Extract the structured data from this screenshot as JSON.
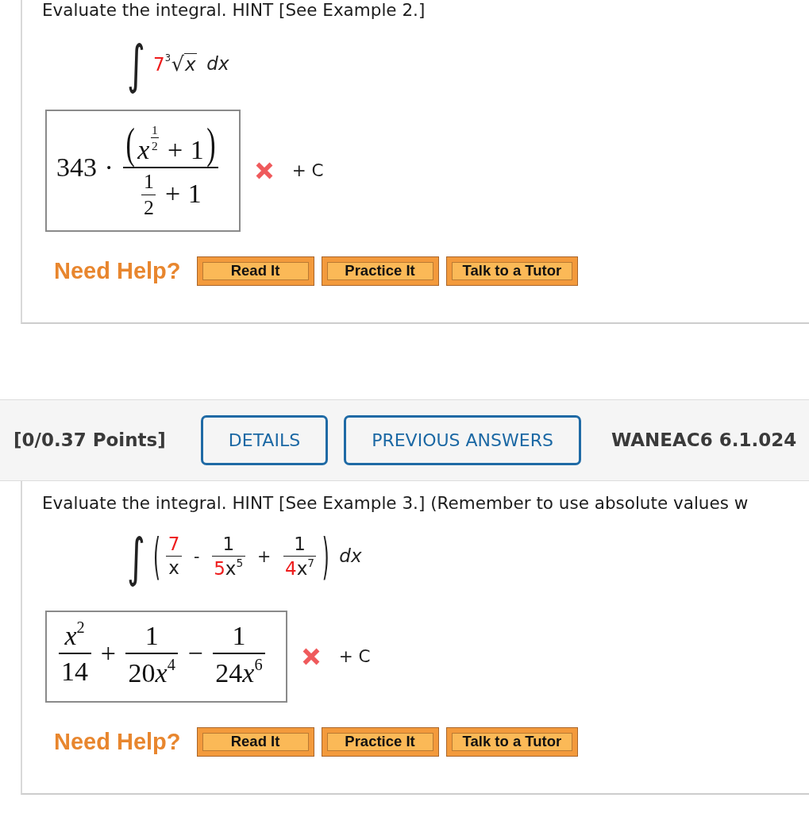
{
  "questions": [
    {
      "prompt": "Evaluate the integral. HINT [See Example 2.]",
      "integral": {
        "kind": "integral",
        "sign": "∫",
        "body": [
          {
            "kind": "param",
            "text": "7"
          },
          {
            "kind": "root",
            "index": "3",
            "sign": "√",
            "body": [
              {
                "kind": "var",
                "text": "x",
                "italic": true
              }
            ]
          }
        ],
        "differential": "dx"
      },
      "answer": [
        {
          "kind": "num",
          "text": "343"
        },
        {
          "kind": "op",
          "text": "·"
        },
        {
          "kind": "frac",
          "num": [
            {
              "kind": "paren",
              "open": "(",
              "close": ")",
              "body": [
                {
                  "kind": "var",
                  "text": "x",
                  "italic": true
                },
                {
                  "kind": "sup",
                  "body": [
                    {
                      "kind": "frac",
                      "num": [
                        {
                          "kind": "num",
                          "text": "1"
                        }
                      ],
                      "den": [
                        {
                          "kind": "num",
                          "text": "2"
                        }
                      ]
                    }
                  ]
                },
                {
                  "kind": "op",
                  "text": "+"
                },
                {
                  "kind": "num",
                  "text": "1"
                }
              ]
            }
          ],
          "den": [
            {
              "kind": "frac",
              "num": [
                {
                  "kind": "num",
                  "text": "1"
                }
              ],
              "den": [
                {
                  "kind": "num",
                  "text": "2"
                }
              ]
            },
            {
              "kind": "op",
              "text": "+"
            },
            {
              "kind": "num",
              "text": "1"
            }
          ]
        }
      ],
      "correct": false,
      "constant": "+ C",
      "help": {
        "label": "Need Help?",
        "buttons": [
          "Read It",
          "Practice It",
          "Talk to a Tutor"
        ]
      }
    },
    {
      "header": {
        "points": "[0/0.37 Points]",
        "buttons": [
          "DETAILS",
          "PREVIOUS ANSWERS"
        ],
        "reference": "WANEAC6 6.1.024"
      },
      "prompt": "Evaluate the integral. HINT [See Example 3.] (Remember to use absolute values w",
      "integral": {
        "kind": "integral",
        "sign": "∫",
        "body": [
          {
            "kind": "paren",
            "open": "(",
            "close": ")",
            "body": [
              {
                "kind": "frac",
                "num": [
                  {
                    "kind": "param",
                    "text": "7"
                  }
                ],
                "den": [
                  {
                    "kind": "var",
                    "text": "x",
                    "italic": false
                  }
                ]
              },
              {
                "kind": "op",
                "text": "-"
              },
              {
                "kind": "frac",
                "num": [
                  {
                    "kind": "num",
                    "text": "1"
                  }
                ],
                "den": [
                  {
                    "kind": "param",
                    "text": "5"
                  },
                  {
                    "kind": "var",
                    "text": "x",
                    "italic": false
                  },
                  {
                    "kind": "sup",
                    "body": [
                      {
                        "kind": "num",
                        "text": "5"
                      }
                    ]
                  }
                ]
              },
              {
                "kind": "op",
                "text": "+"
              },
              {
                "kind": "frac",
                "num": [
                  {
                    "kind": "num",
                    "text": "1"
                  }
                ],
                "den": [
                  {
                    "kind": "param",
                    "text": "4"
                  },
                  {
                    "kind": "var",
                    "text": "x",
                    "italic": false
                  },
                  {
                    "kind": "sup",
                    "body": [
                      {
                        "kind": "num",
                        "text": "7"
                      }
                    ]
                  }
                ]
              }
            ]
          }
        ],
        "differential": "dx"
      },
      "answer": [
        {
          "kind": "frac",
          "num": [
            {
              "kind": "var",
              "text": "x",
              "italic": true
            },
            {
              "kind": "sup",
              "body": [
                {
                  "kind": "num",
                  "text": "2"
                }
              ]
            }
          ],
          "den": [
            {
              "kind": "num",
              "text": "14"
            }
          ]
        },
        {
          "kind": "op",
          "text": "+"
        },
        {
          "kind": "frac",
          "num": [
            {
              "kind": "num",
              "text": "1"
            }
          ],
          "den": [
            {
              "kind": "num",
              "text": "20"
            },
            {
              "kind": "var",
              "text": "x",
              "italic": true
            },
            {
              "kind": "sup",
              "body": [
                {
                  "kind": "num",
                  "text": "4"
                }
              ]
            }
          ]
        },
        {
          "kind": "op",
          "text": "−"
        },
        {
          "kind": "frac",
          "num": [
            {
              "kind": "num",
              "text": "1"
            }
          ],
          "den": [
            {
              "kind": "num",
              "text": "24"
            },
            {
              "kind": "var",
              "text": "x",
              "italic": true
            },
            {
              "kind": "sup",
              "body": [
                {
                  "kind": "num",
                  "text": "6"
                }
              ]
            }
          ]
        }
      ],
      "correct": false,
      "constant": "+ C",
      "help": {
        "label": "Need Help?",
        "buttons": [
          "Read It",
          "Practice It",
          "Talk to a Tutor"
        ]
      }
    }
  ]
}
